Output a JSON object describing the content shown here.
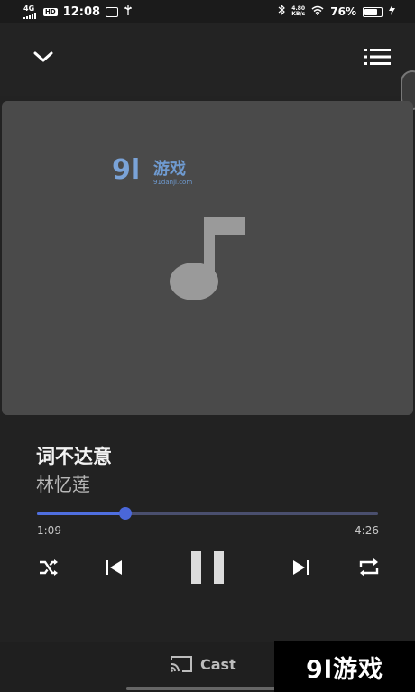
{
  "status": {
    "signal_label": "4G",
    "hd_label": "HD",
    "time": "12:08",
    "speed_top": "4.80",
    "speed_bottom": "KB/s",
    "battery_pct": "76%",
    "battery_level": 0.76
  },
  "watermark": {
    "logo_number": "9l",
    "logo_text": "游戏",
    "logo_url": "91danji.com",
    "corner_text": "9l游戏"
  },
  "song": {
    "title": "词不达意",
    "artist": "林忆莲"
  },
  "progress": {
    "elapsed": "1:09",
    "total": "4:26",
    "fraction": 0.259
  },
  "cast": {
    "label": "Cast"
  },
  "colors": {
    "accent": "#4a67d9",
    "background": "#222222",
    "artwork_bg": "#4a4a4a",
    "note": "#9a9a9a"
  },
  "icons": {
    "collapse": "chevron-down-icon",
    "queue": "queue-list-icon",
    "shuffle": "shuffle-icon",
    "previous": "skip-previous-icon",
    "pause": "pause-icon",
    "next": "skip-next-icon",
    "repeat": "repeat-icon",
    "cast": "cast-icon",
    "artwork": "music-note-icon"
  }
}
